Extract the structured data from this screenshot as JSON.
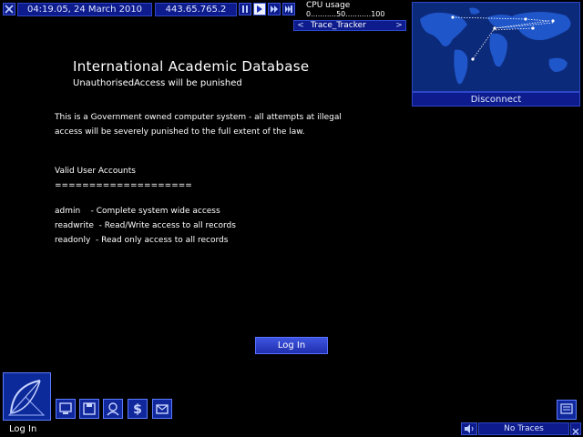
{
  "topbar": {
    "datetime": "04:19.05, 24 March 2010",
    "ip": "443.65.765.2",
    "cpu_label": "CPU usage",
    "cpu_scale": "0...........50...........100",
    "trace_label": "Trace_Tracker",
    "trace_prev": "<",
    "trace_next": ">"
  },
  "map": {
    "disconnect_label": "Disconnect"
  },
  "main": {
    "title": "International Academic Database",
    "subtitle": "UnauthorisedAccess will be punished",
    "warning": "This is a Government owned computer system - all attempts at illegal access will be severely punished to the full extent of the law.",
    "accounts_header": "Valid User Accounts",
    "separator": "====================",
    "accounts": [
      "admin    - Complete system wide access",
      "readwrite  - Read/Write access to all records",
      "readonly  - Read only access to all records"
    ],
    "login_label": "Log In"
  },
  "bottombar": {
    "status": "Log In",
    "traces": "No Traces"
  },
  "colors": {
    "panel": "#0d1b8c",
    "panel_border": "#2e46c8",
    "map_bg": "#0c2a7a",
    "button": "#2f45d0"
  }
}
